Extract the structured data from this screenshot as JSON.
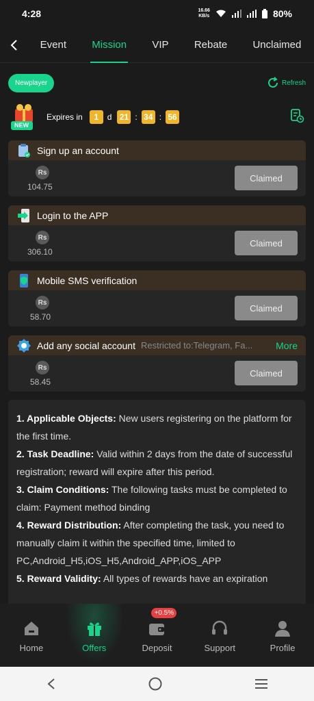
{
  "status_bar": {
    "time": "4:28",
    "net_speed_value": "16.66",
    "net_speed_unit": "KB/s",
    "battery": "80%"
  },
  "tabs": [
    {
      "label": "Event"
    },
    {
      "label": "Mission",
      "active": true
    },
    {
      "label": "VIP"
    },
    {
      "label": "Rebate"
    },
    {
      "label": "Unclaimed"
    }
  ],
  "header": {
    "newplayer_label": "Newplayer",
    "refresh_label": "Refresh"
  },
  "badge": {
    "text": "NEW"
  },
  "countdown": {
    "label": "Expires in",
    "days": "1",
    "day_unit": "d",
    "hours": "21",
    "minutes": "34",
    "seconds": "56",
    "separator": ":"
  },
  "tasks": [
    {
      "title": "Sign up an account",
      "currency": "Rs",
      "reward": "104.75",
      "button": "Claimed",
      "icon": "clipboard-check-icon"
    },
    {
      "title": "Login to the APP",
      "currency": "Rs",
      "reward": "306.10",
      "button": "Claimed",
      "icon": "login-arrow-icon"
    },
    {
      "title": "Mobile SMS verification",
      "currency": "Rs",
      "reward": "58.70",
      "button": "Claimed",
      "icon": "phone-shield-icon"
    },
    {
      "title": "Add any social account",
      "restriction": "Restricted to:Telegram, Fa...",
      "more": "More",
      "currency": "Rs",
      "reward": "58.45",
      "button": "Claimed",
      "icon": "social-badge-icon"
    }
  ],
  "rules": [
    {
      "title": "1. Applicable Objects:",
      "text": " New users registering on the platform for the first time."
    },
    {
      "title": "2. Task Deadline:",
      "text": " Valid within 2 days from the date of successful registration; reward will expire after this period."
    },
    {
      "title": "3. Claim Conditions:",
      "text": " The following tasks must be completed to claim: Payment method binding"
    },
    {
      "title": "4. Reward Distribution:",
      "text": " After completing the task, you need to manually claim it within the specified time, limited to PC,Android_H5,iOS_H5,Android_APP,iOS_APP"
    },
    {
      "title": "5. Reward Validity:",
      "text": " All types of rewards have an expiration"
    }
  ],
  "bottom_nav": [
    {
      "label": "Home",
      "icon": "home-icon"
    },
    {
      "label": "Offers",
      "icon": "gift-icon",
      "active": true
    },
    {
      "label": "Deposit",
      "icon": "wallet-icon",
      "badge": "+0.5%"
    },
    {
      "label": "Support",
      "icon": "headset-icon"
    },
    {
      "label": "Profile",
      "icon": "profile-icon"
    }
  ],
  "colors": {
    "accent": "#19d48c",
    "countdown_box": "#f0b528",
    "task_header": "#3a2f22",
    "claimed_button": "#8a8a8a",
    "background": "#1b1b1b"
  }
}
